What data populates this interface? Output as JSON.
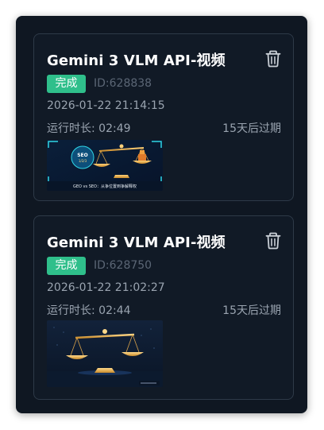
{
  "tasks": [
    {
      "title": "Gemini 3 VLM API-视频",
      "status": "完成",
      "id_label": "ID:628838",
      "created_at": "2026-01-22 21:14:15",
      "runtime_label": "运行时长: 02:49",
      "expire_label": "15天后过期",
      "thumbnail": {
        "icon": "scale-of-justice-image",
        "badge_text": "SEO 排名规则 1/2/3",
        "caption": "GEO vs SEO: 从争位置到争解释权"
      },
      "delete_icon": "trash-icon"
    },
    {
      "title": "Gemini 3 VLM API-视频",
      "status": "完成",
      "id_label": "ID:628750",
      "created_at": "2026-01-22 21:02:27",
      "runtime_label": "运行时长: 02:44",
      "expire_label": "15天后过期",
      "thumbnail": {
        "icon": "scale-of-justice-image"
      },
      "delete_icon": "trash-icon"
    }
  ],
  "colors": {
    "background": "#0f1722",
    "card_border": "#2e3a48",
    "status_badge": "#2fbf8b",
    "title": "#ffffff",
    "meta_text": "#9aa4b0",
    "id_text": "#5b6675"
  }
}
